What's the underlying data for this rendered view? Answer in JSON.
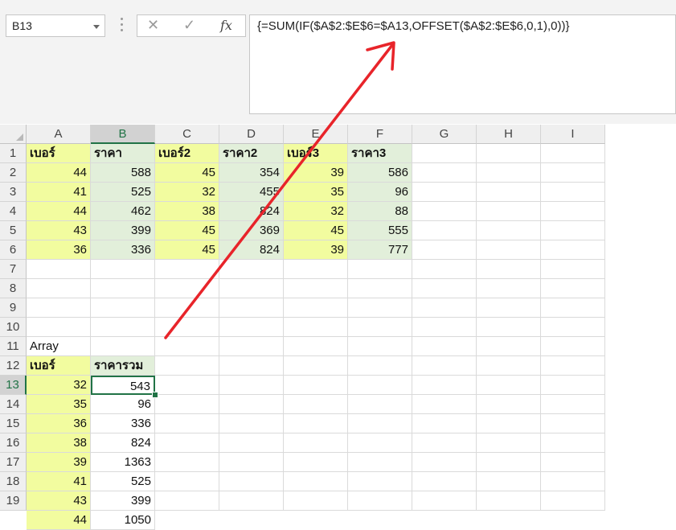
{
  "name_box": "B13",
  "formula_bar": {
    "cancel_glyph": "✕",
    "enter_glyph": "✓",
    "fx_label": "fx",
    "formula": "{=SUM(IF($A$2:$E$6=$A13,OFFSET($A$2:$E$6,0,1),0))}"
  },
  "columns": [
    "A",
    "B",
    "C",
    "D",
    "E",
    "F",
    "G",
    "H",
    "I"
  ],
  "selected_column": "B",
  "rows": [
    "1",
    "2",
    "3",
    "4",
    "5",
    "6",
    "7",
    "8",
    "9",
    "10",
    "11",
    "12",
    "13",
    "14",
    "15",
    "16",
    "17",
    "18",
    "19"
  ],
  "selected_row": "13",
  "table": {
    "headers": [
      "เบอร์",
      "ราคา",
      "เบอร์2",
      "ราคา2",
      "เบอร์3",
      "ราคา3"
    ],
    "data": [
      [
        44,
        588,
        45,
        354,
        39,
        586
      ],
      [
        41,
        525,
        32,
        455,
        35,
        96
      ],
      [
        44,
        462,
        38,
        824,
        32,
        88
      ],
      [
        43,
        399,
        45,
        369,
        45,
        555
      ],
      [
        36,
        336,
        45,
        824,
        39,
        777
      ]
    ]
  },
  "array_label": "Array",
  "result": {
    "headers": [
      "เบอร์",
      "ราคารวม"
    ],
    "rows": [
      [
        32,
        543
      ],
      [
        35,
        96
      ],
      [
        36,
        336
      ],
      [
        38,
        824
      ],
      [
        39,
        1363
      ],
      [
        41,
        525
      ],
      [
        43,
        399
      ],
      [
        44,
        1050
      ]
    ]
  },
  "colors": {
    "yellow": "#f2fc9f",
    "green": "#e2efda",
    "excel_green": "#217346",
    "arrow": "#e8242a"
  }
}
